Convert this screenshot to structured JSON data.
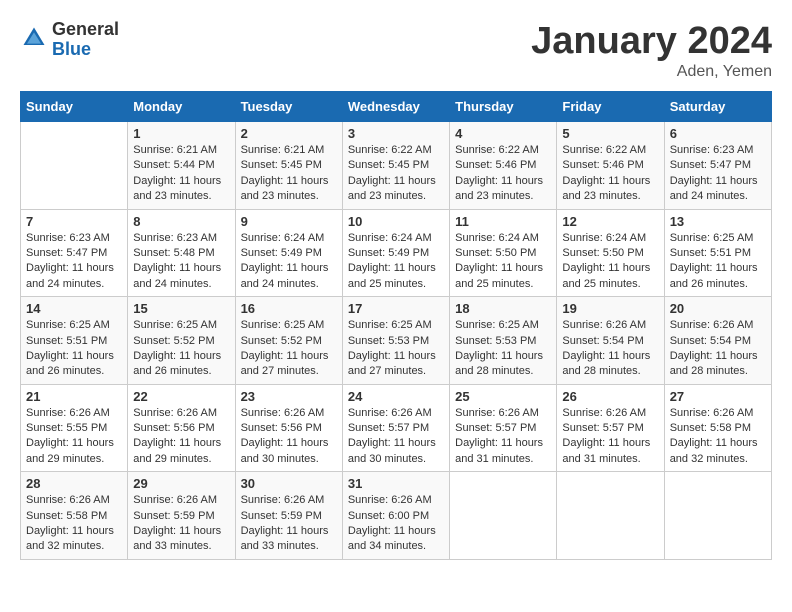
{
  "header": {
    "logo_general": "General",
    "logo_blue": "Blue",
    "month": "January 2024",
    "location": "Aden, Yemen"
  },
  "weekdays": [
    "Sunday",
    "Monday",
    "Tuesday",
    "Wednesday",
    "Thursday",
    "Friday",
    "Saturday"
  ],
  "weeks": [
    [
      {
        "day": "",
        "info": ""
      },
      {
        "day": "1",
        "info": "Sunrise: 6:21 AM\nSunset: 5:44 PM\nDaylight: 11 hours\nand 23 minutes."
      },
      {
        "day": "2",
        "info": "Sunrise: 6:21 AM\nSunset: 5:45 PM\nDaylight: 11 hours\nand 23 minutes."
      },
      {
        "day": "3",
        "info": "Sunrise: 6:22 AM\nSunset: 5:45 PM\nDaylight: 11 hours\nand 23 minutes."
      },
      {
        "day": "4",
        "info": "Sunrise: 6:22 AM\nSunset: 5:46 PM\nDaylight: 11 hours\nand 23 minutes."
      },
      {
        "day": "5",
        "info": "Sunrise: 6:22 AM\nSunset: 5:46 PM\nDaylight: 11 hours\nand 23 minutes."
      },
      {
        "day": "6",
        "info": "Sunrise: 6:23 AM\nSunset: 5:47 PM\nDaylight: 11 hours\nand 24 minutes."
      }
    ],
    [
      {
        "day": "7",
        "info": "Sunrise: 6:23 AM\nSunset: 5:47 PM\nDaylight: 11 hours\nand 24 minutes."
      },
      {
        "day": "8",
        "info": "Sunrise: 6:23 AM\nSunset: 5:48 PM\nDaylight: 11 hours\nand 24 minutes."
      },
      {
        "day": "9",
        "info": "Sunrise: 6:24 AM\nSunset: 5:49 PM\nDaylight: 11 hours\nand 24 minutes."
      },
      {
        "day": "10",
        "info": "Sunrise: 6:24 AM\nSunset: 5:49 PM\nDaylight: 11 hours\nand 25 minutes."
      },
      {
        "day": "11",
        "info": "Sunrise: 6:24 AM\nSunset: 5:50 PM\nDaylight: 11 hours\nand 25 minutes."
      },
      {
        "day": "12",
        "info": "Sunrise: 6:24 AM\nSunset: 5:50 PM\nDaylight: 11 hours\nand 25 minutes."
      },
      {
        "day": "13",
        "info": "Sunrise: 6:25 AM\nSunset: 5:51 PM\nDaylight: 11 hours\nand 26 minutes."
      }
    ],
    [
      {
        "day": "14",
        "info": "Sunrise: 6:25 AM\nSunset: 5:51 PM\nDaylight: 11 hours\nand 26 minutes."
      },
      {
        "day": "15",
        "info": "Sunrise: 6:25 AM\nSunset: 5:52 PM\nDaylight: 11 hours\nand 26 minutes."
      },
      {
        "day": "16",
        "info": "Sunrise: 6:25 AM\nSunset: 5:52 PM\nDaylight: 11 hours\nand 27 minutes."
      },
      {
        "day": "17",
        "info": "Sunrise: 6:25 AM\nSunset: 5:53 PM\nDaylight: 11 hours\nand 27 minutes."
      },
      {
        "day": "18",
        "info": "Sunrise: 6:25 AM\nSunset: 5:53 PM\nDaylight: 11 hours\nand 28 minutes."
      },
      {
        "day": "19",
        "info": "Sunrise: 6:26 AM\nSunset: 5:54 PM\nDaylight: 11 hours\nand 28 minutes."
      },
      {
        "day": "20",
        "info": "Sunrise: 6:26 AM\nSunset: 5:54 PM\nDaylight: 11 hours\nand 28 minutes."
      }
    ],
    [
      {
        "day": "21",
        "info": "Sunrise: 6:26 AM\nSunset: 5:55 PM\nDaylight: 11 hours\nand 29 minutes."
      },
      {
        "day": "22",
        "info": "Sunrise: 6:26 AM\nSunset: 5:56 PM\nDaylight: 11 hours\nand 29 minutes."
      },
      {
        "day": "23",
        "info": "Sunrise: 6:26 AM\nSunset: 5:56 PM\nDaylight: 11 hours\nand 30 minutes."
      },
      {
        "day": "24",
        "info": "Sunrise: 6:26 AM\nSunset: 5:57 PM\nDaylight: 11 hours\nand 30 minutes."
      },
      {
        "day": "25",
        "info": "Sunrise: 6:26 AM\nSunset: 5:57 PM\nDaylight: 11 hours\nand 31 minutes."
      },
      {
        "day": "26",
        "info": "Sunrise: 6:26 AM\nSunset: 5:57 PM\nDaylight: 11 hours\nand 31 minutes."
      },
      {
        "day": "27",
        "info": "Sunrise: 6:26 AM\nSunset: 5:58 PM\nDaylight: 11 hours\nand 32 minutes."
      }
    ],
    [
      {
        "day": "28",
        "info": "Sunrise: 6:26 AM\nSunset: 5:58 PM\nDaylight: 11 hours\nand 32 minutes."
      },
      {
        "day": "29",
        "info": "Sunrise: 6:26 AM\nSunset: 5:59 PM\nDaylight: 11 hours\nand 33 minutes."
      },
      {
        "day": "30",
        "info": "Sunrise: 6:26 AM\nSunset: 5:59 PM\nDaylight: 11 hours\nand 33 minutes."
      },
      {
        "day": "31",
        "info": "Sunrise: 6:26 AM\nSunset: 6:00 PM\nDaylight: 11 hours\nand 34 minutes."
      },
      {
        "day": "",
        "info": ""
      },
      {
        "day": "",
        "info": ""
      },
      {
        "day": "",
        "info": ""
      }
    ]
  ]
}
